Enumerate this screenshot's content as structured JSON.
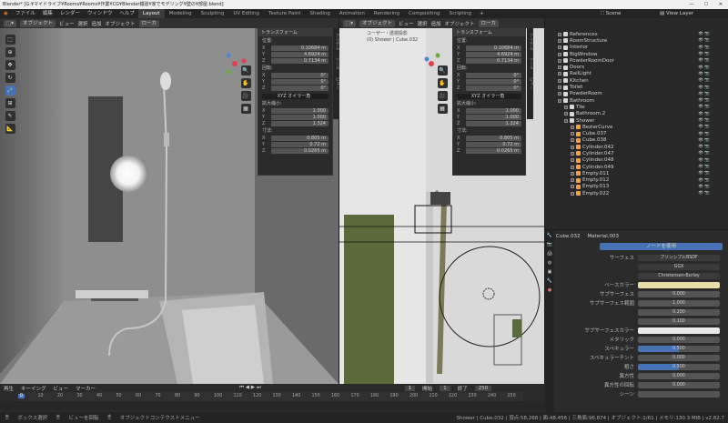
{
  "title": "Blender* [G:¥マイドライブ¥Rooms¥Rooms¥作業¥CG¥Blender鐵道¥家でモデリング¥壁の¥部屋.blend]",
  "menu": [
    "ファイル",
    "編集",
    "レンダー",
    "ウィンドウ",
    "ヘルプ"
  ],
  "workspaces": [
    "Layout",
    "Modeling",
    "Sculpting",
    "UV Editing",
    "Texture Paint",
    "Shading",
    "Animation",
    "Rendering",
    "Compositing",
    "Scripting"
  ],
  "scene": "Scene",
  "view_layer": "View Layer",
  "left_header": [
    "オブジェクト",
    "ビュー",
    "選択",
    "追加",
    "オブジェクト",
    "ローカ"
  ],
  "right_header": [
    "オブジェクト",
    "ビュー",
    "選択",
    "追加",
    "オブジェクト",
    "ローカ"
  ],
  "right_overlay": [
    "ユーザー・透視投影",
    "(0) Shower | Cube.032"
  ],
  "transform": {
    "header": "トランスフォーム",
    "location_label": "位置:",
    "location": [
      [
        "X",
        "0.10684 m"
      ],
      [
        "Y",
        "4.6924 m"
      ],
      [
        "Z",
        "0.7134 m"
      ]
    ],
    "rotation_label": "回転:",
    "rotation": [
      [
        "X",
        "0°"
      ],
      [
        "Y",
        "0°"
      ],
      [
        "Z",
        "0°"
      ]
    ],
    "rotation_mode": "XYZ オイラー角",
    "scale_label": "拡大縮小:",
    "scale": [
      [
        "X",
        "1.000"
      ],
      [
        "Y",
        "1.000"
      ],
      [
        "Z",
        "1.324"
      ]
    ],
    "dims_label": "寸法:",
    "dims": [
      [
        "X",
        "0.805 m"
      ],
      [
        "Y",
        "0.72 m"
      ],
      [
        "Z",
        "0.0265 m"
      ]
    ]
  },
  "sidebar_tabs": [
    "アイテム",
    "ツール",
    "ビュー"
  ],
  "outliner": [
    {
      "name": "References",
      "d": 0
    },
    {
      "name": "RoomStructure",
      "d": 0
    },
    {
      "name": "Interior",
      "d": 0
    },
    {
      "name": "BigWindow",
      "d": 0
    },
    {
      "name": "PowderRoomDoor",
      "d": 0
    },
    {
      "name": "Doors",
      "d": 0
    },
    {
      "name": "RailLight",
      "d": 0
    },
    {
      "name": "Kitchen",
      "d": 0
    },
    {
      "name": "Toilet",
      "d": 0
    },
    {
      "name": "PowderRoom",
      "d": 0
    },
    {
      "name": "Bathroom",
      "d": 0
    },
    {
      "name": "Tile",
      "d": 1
    },
    {
      "name": "Bathroom.2",
      "d": 1
    },
    {
      "name": "Shower",
      "d": 1
    },
    {
      "name": "BezierCurve",
      "d": 2
    },
    {
      "name": "Cube.037",
      "d": 2
    },
    {
      "name": "Cube.038",
      "d": 2
    },
    {
      "name": "Cylinder.042",
      "d": 2
    },
    {
      "name": "Cylinder.047",
      "d": 2
    },
    {
      "name": "Cylinder.048",
      "d": 2
    },
    {
      "name": "Cylinder.049",
      "d": 2
    },
    {
      "name": "Empty.011",
      "d": 2
    },
    {
      "name": "Empty.012",
      "d": 2
    },
    {
      "name": "Empty.013",
      "d": 2
    },
    {
      "name": "Empty.022",
      "d": 2
    }
  ],
  "props": {
    "object": "Cube.032",
    "material": "Material.003",
    "use_nodes": "ノードを使用",
    "rows": [
      {
        "label": "サーフェス",
        "value": "プリンシプルBSDF"
      },
      {
        "label": "",
        "value": "GGX"
      },
      {
        "label": "",
        "value": "Christensen-Burley"
      },
      {
        "label": "ベースカラー",
        "value": ""
      },
      {
        "label": "サブサーフェス",
        "value": "0.000"
      },
      {
        "label": "サブサーフェス範囲",
        "value": "1.000"
      },
      {
        "label": "",
        "value": "0.200"
      },
      {
        "label": "",
        "value": "0.100"
      },
      {
        "label": "サブサーフェスカラー",
        "value": ""
      },
      {
        "label": "メタリック",
        "value": "0.000"
      },
      {
        "label": "スペキュラー",
        "value": "0.500"
      },
      {
        "label": "スペキュラーチント",
        "value": "0.000"
      },
      {
        "label": "粗さ",
        "value": "0.500"
      },
      {
        "label": "異方性",
        "value": "0.000"
      },
      {
        "label": "異方性の回転",
        "value": "0.000"
      },
      {
        "label": "シーン",
        "value": ""
      }
    ]
  },
  "timeline": {
    "menu": [
      "再生",
      "キーイング",
      "ビュー",
      "マーカー"
    ],
    "current": "1",
    "start_label": "開始",
    "start": "1",
    "end_label": "終了",
    "end": "250",
    "ticks": [
      "0",
      "10",
      "20",
      "30",
      "40",
      "50",
      "60",
      "70",
      "80",
      "90",
      "100",
      "110",
      "120",
      "130",
      "140",
      "150",
      "160",
      "170",
      "180",
      "190",
      "200",
      "210",
      "220",
      "230",
      "240",
      "250"
    ]
  },
  "status": {
    "select": "ボックス選択",
    "rotate": "ビューを回転",
    "menu": "オブジェクトコンテクストメニュー",
    "info": "Shower | Cube.032 | 頂点:58,268 | 面:48,456 | 三角面:96,874 | オブジェクト:1/61 | メモリ:130.3 MiB | v2.82.7"
  }
}
